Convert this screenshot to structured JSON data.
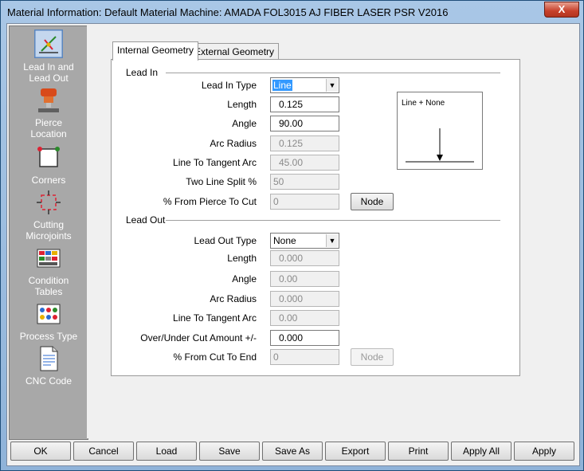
{
  "window": {
    "title": "Material Information: Default Material     Machine: AMADA FOL3015 AJ FIBER LASER PSR V2016",
    "close_label": "X"
  },
  "sidebar": {
    "items": [
      {
        "label_line1": "Lead In and",
        "label_line2": "Lead Out",
        "icon": "lead-in-lead-out-icon"
      },
      {
        "label_line1": "Pierce",
        "label_line2": "Location",
        "icon": "pierce-location-icon"
      },
      {
        "label_line1": "Corners",
        "label_line2": "",
        "icon": "corners-icon"
      },
      {
        "label_line1": "Cutting",
        "label_line2": "Microjoints",
        "icon": "cutting-microjoints-icon"
      },
      {
        "label_line1": "Condition",
        "label_line2": "Tables",
        "icon": "condition-tables-icon"
      },
      {
        "label_line1": "Process Type",
        "label_line2": "",
        "icon": "process-type-icon"
      },
      {
        "label_line1": "CNC Code",
        "label_line2": "",
        "icon": "cnc-code-icon"
      }
    ]
  },
  "tabs": [
    {
      "label": "Internal Geometry"
    },
    {
      "label": "External Geometry"
    }
  ],
  "lead_in": {
    "group_title": "Lead In",
    "type_label": "Lead In Type",
    "type_value": "Line",
    "length_label": "Length",
    "length_value": "0.125",
    "angle_label": "Angle",
    "angle_value": "90.00",
    "arc_radius_label": "Arc Radius",
    "arc_radius_value": "0.125",
    "line_tangent_label": "Line To Tangent Arc",
    "line_tangent_value": "45.00",
    "two_line_label": "Two Line Split %",
    "two_line_value": "50",
    "pierce_to_cut_label": "% From Pierce To Cut",
    "pierce_to_cut_value": "0",
    "node_label": "Node",
    "preview_text": "Line + None"
  },
  "lead_out": {
    "group_title": "Lead Out",
    "type_label": "Lead Out Type",
    "type_value": "None",
    "length_label": "Length",
    "length_value": "0.000",
    "angle_label": "Angle",
    "angle_value": "0.00",
    "arc_radius_label": "Arc Radius",
    "arc_radius_value": "0.000",
    "line_tangent_label": "Line To Tangent Arc",
    "line_tangent_value": "0.00",
    "overcut_label": "Over/Under Cut Amount +/-",
    "overcut_value": "0.000",
    "cut_to_end_label": "% From Cut To End",
    "cut_to_end_value": "0",
    "node_label": "Node"
  },
  "buttons": {
    "ok": "OK",
    "cancel": "Cancel",
    "load": "Load",
    "save": "Save",
    "save_as": "Save As",
    "export": "Export",
    "print": "Print",
    "apply_all": "Apply All",
    "apply": "Apply"
  }
}
